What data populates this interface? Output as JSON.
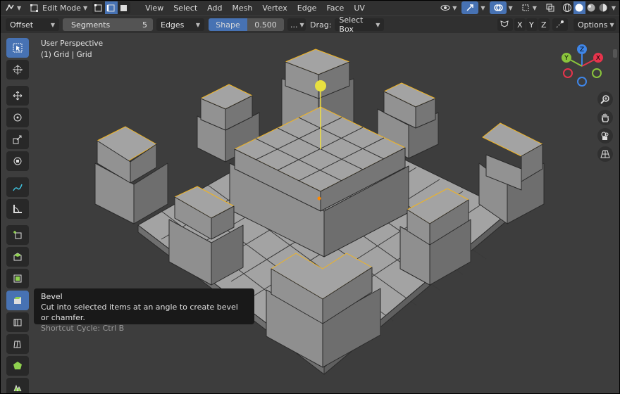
{
  "header": {
    "mode_label": "Edit Mode",
    "menus": [
      "View",
      "Select",
      "Add",
      "Mesh",
      "Vertex",
      "Edge",
      "Face",
      "UV"
    ]
  },
  "toolset": {
    "offset_label": "Offset",
    "segments_label": "Segments",
    "segments_value": "5",
    "affect_label": "Edges",
    "shape_label": "Shape",
    "shape_value": "0.500",
    "more_label": "...",
    "drag_label": "Drag:",
    "drag_value": "Select Box",
    "axis_x": "X",
    "axis_y": "Y",
    "axis_z": "Z",
    "options_label": "Options"
  },
  "viewport": {
    "perspective_label": "User Perspective",
    "object_label": "(1) Grid | Grid"
  },
  "tooltip": {
    "title": "Bevel",
    "description": "Cut into selected items at an angle to create bevel or chamfer.",
    "shortcut": "Shortcut Cycle: Ctrl B"
  },
  "gizmo": {
    "x_label": "X",
    "y_label": "Y",
    "z_label": "Z",
    "x_color": "#e7344c",
    "y_color": "#8ac53c",
    "z_color": "#3f86e8"
  },
  "colors": {
    "selected_edge": "#f0b423",
    "active_tool": "#4772b3",
    "mesh_top": "#a3a3a3",
    "mesh_side": "#8a8a8a"
  }
}
